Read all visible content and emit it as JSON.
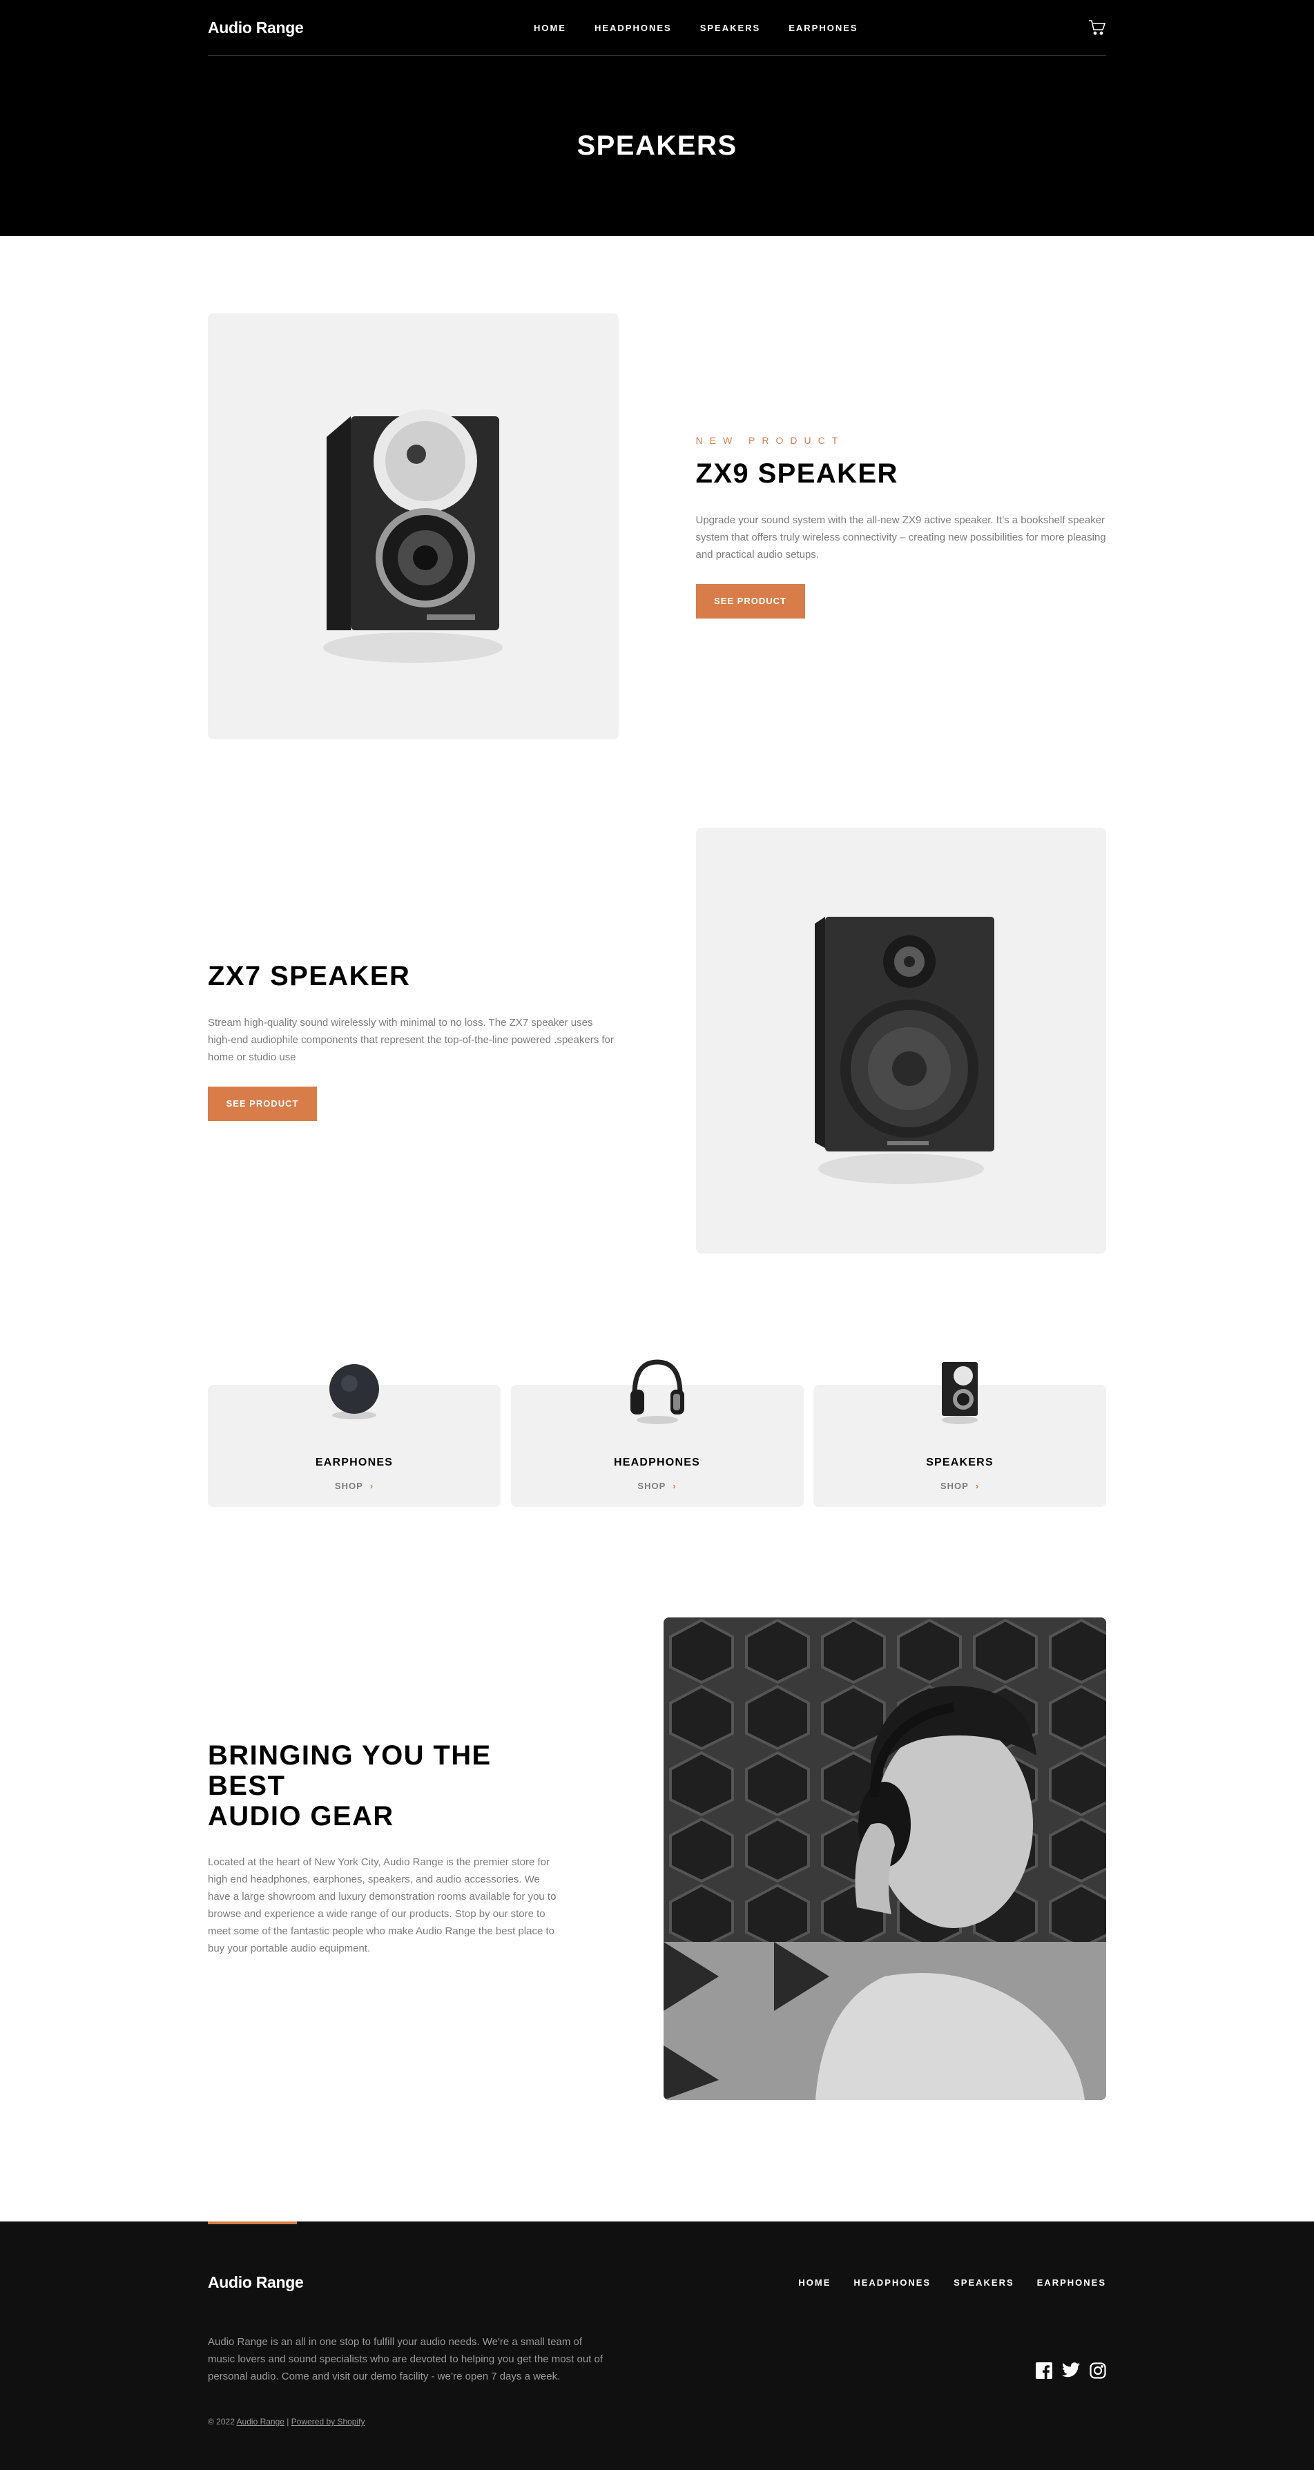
{
  "header": {
    "logo": "Audio Range",
    "nav": [
      "HOME",
      "HEADPHONES",
      "SPEAKERS",
      "EARPHONES"
    ],
    "cart_icon": "cart-icon",
    "page_title": "SPEAKERS"
  },
  "products": [
    {
      "overline": "NEW PRODUCT",
      "title": "ZX9 SPEAKER",
      "description_lines": [
        "Upgrade your sound system with the all-new ZX9 active speaker. It’s a bookshelf speaker",
        "system that offers truly wireless connectivity – creating new possibilities for more pleasing and practical audio setups."
      ],
      "button": "SEE PRODUCT"
    },
    {
      "title": "ZX7 SPEAKER",
      "description": "Stream high-quality sound wirelessly with minimal to no loss. The ZX7 speaker uses high-end audiophile components that represent the top-of-the-line powered .speakers for home or studio use",
      "button": "SEE PRODUCT"
    }
  ],
  "categories": [
    {
      "name": "EARPHONES",
      "shop": "SHOP",
      "chevron": "›"
    },
    {
      "name": "HEADPHONES",
      "shop": "SHOP",
      "chevron": "›"
    },
    {
      "name": "SPEAKERS",
      "shop": "SHOP",
      "chevron": "›"
    }
  ],
  "about": {
    "title_line1": "BRINGING YOU THE BEST",
    "title_line2": "AUDIO GEAR",
    "text": "Located at the heart of New York City, Audio Range is the premier store for high end headphones, earphones, speakers, and audio accessories. We have a large showroom and luxury demonstration rooms available for you to browse and experience a wide range of our products. Stop by our store to meet some of the fantastic people who make Audio Range the best place to buy your portable audio equipment."
  },
  "footer": {
    "logo": "Audio Range",
    "nav": [
      "HOME",
      "HEADPHONES",
      "SPEAKERS",
      "EARPHONES"
    ],
    "about": "Audio Range is an all in one stop to fulfill your audio needs. We're a small team of music lovers and sound specialists who are devoted to helping you get the most out of personal audio. Come and visit our demo facility - we’re open 7 days a week.",
    "copyright_prefix": "© 2022",
    "copyright_store": "Audio Range",
    "copyright_sep": "|",
    "powered_by": "Powered by Shopify",
    "social": [
      "facebook-icon",
      "twitter-icon",
      "instagram-icon"
    ]
  },
  "colors": {
    "accent": "#D87D4A",
    "dark": "#000000",
    "light_gray": "#F1F1F1"
  }
}
